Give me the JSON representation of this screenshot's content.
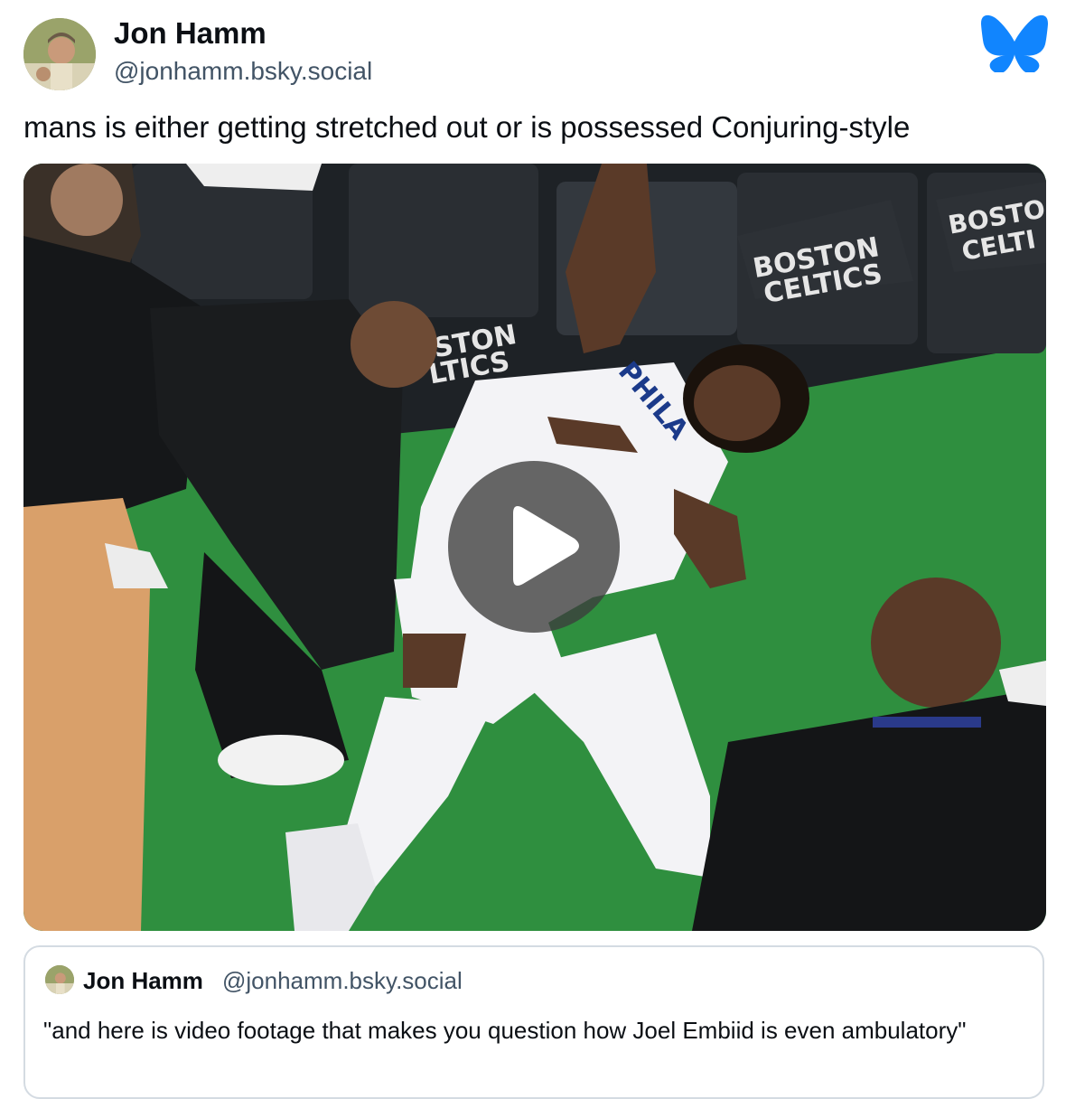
{
  "author": {
    "display_name": "Jon Hamm",
    "handle": "@jonhamm.bsky.social",
    "avatar_icon": "user-avatar"
  },
  "post": {
    "text": "mans is either getting stretched out or is possessed Conjuring-style"
  },
  "video": {
    "play_icon": "play-icon",
    "signage_1": "BOSTON CELTICS",
    "jersey_text": "PHILA"
  },
  "quote": {
    "display_name": "Jon Hamm",
    "handle": "@jonhamm.bsky.social",
    "text": "\"and here is video footage that makes you question how Joel Embiid is even ambulatory\""
  },
  "colors": {
    "brand_blue": "#1185fe",
    "court_green": "#2a8a3a",
    "secondary_text": "#425466"
  }
}
